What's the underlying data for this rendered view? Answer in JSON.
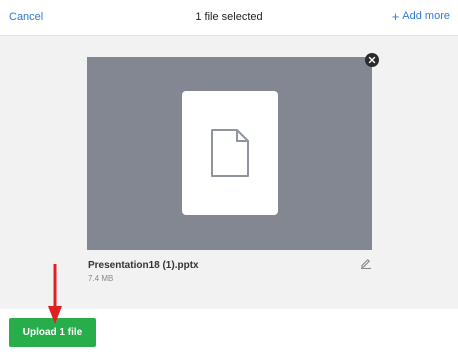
{
  "header": {
    "cancel_label": "Cancel",
    "title": "1 file selected",
    "add_more_label": "Add more"
  },
  "file": {
    "name": "Presentation18 (1).pptx",
    "size": "7.4 MB"
  },
  "footer": {
    "upload_label": "Upload 1 file"
  },
  "colors": {
    "accent": "#2f7ad1",
    "upload_button": "#27ae4b",
    "preview_background": "#838792",
    "annotation_arrow": "#e02020"
  },
  "icons": {
    "close": "close-icon",
    "document": "document-icon",
    "edit": "pencil-icon",
    "add": "plus-icon",
    "annotation": "arrow-down-icon"
  }
}
